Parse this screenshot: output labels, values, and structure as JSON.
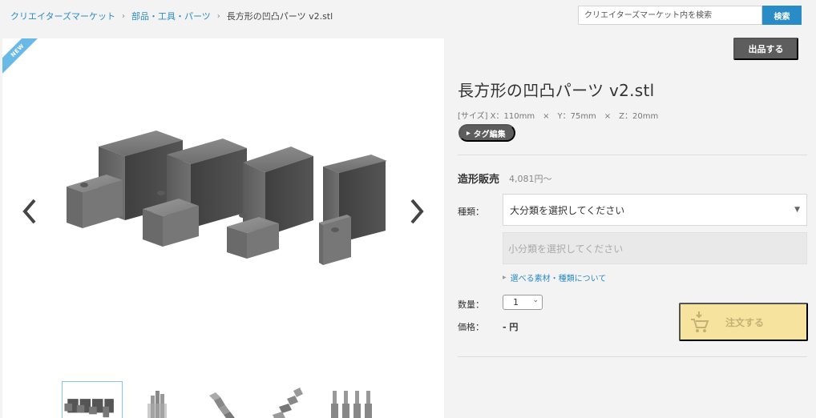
{
  "breadcrumb": {
    "items": [
      "クリエイターズマーケット",
      "部品・工具・パーツ"
    ],
    "current": "長方形の凹凸パーツ v2.stl",
    "separator": "›"
  },
  "search": {
    "placeholder": "クリエイターズマーケット内を検索",
    "button_label": "検索"
  },
  "gallery": {
    "badge": "NEW",
    "thumbnail_count": 5
  },
  "header": {
    "listing_button": "出品する"
  },
  "product": {
    "title": "長方形の凹凸パーツ v2.stl",
    "size": "[サイズ] X：110mm　×　Y：75mm　×　Z：20mm",
    "tag_button": "タグ編集"
  },
  "sale": {
    "label": "造形販売",
    "price": "4,081円〜"
  },
  "form": {
    "type_label": "種類：",
    "category_placeholder": "大分類を選択してください",
    "subcategory_placeholder": "小分類を選択してください",
    "materials_link": "選べる素材・種類について",
    "quantity_label": "数量：",
    "quantity_value": "1",
    "price_label": "価格：",
    "price_value": "- 円",
    "order_button": "注文する"
  },
  "colors": {
    "accent": "#2a8cc7",
    "order_button": "#f6e39e",
    "dark_button": "#5d5d5d",
    "new_badge": "#69b9e6"
  }
}
